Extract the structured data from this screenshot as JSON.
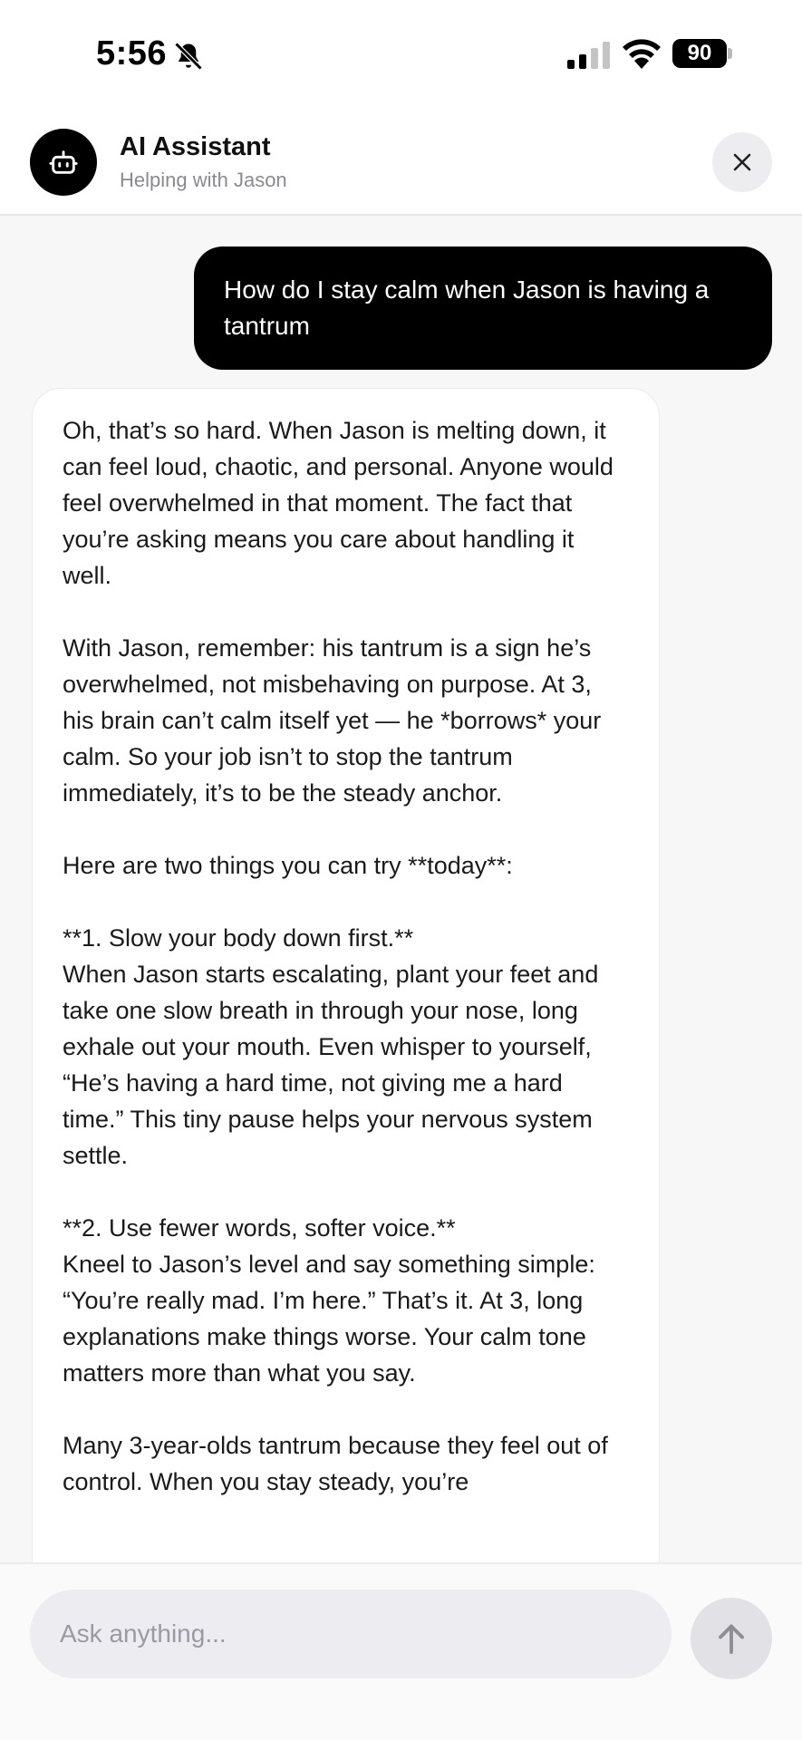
{
  "status_bar": {
    "time": "5:56",
    "battery": "90",
    "icons": [
      "bell-slash-icon",
      "cellular-signal-icon",
      "wifi-icon",
      "battery-icon"
    ]
  },
  "header": {
    "title": "AI Assistant",
    "subtitle": "Helping with Jason",
    "avatar_icon": "robot-icon",
    "close_icon": "close-icon"
  },
  "messages": {
    "user": "How do I stay calm when Jason is having a tantrum",
    "assistant": {
      "p1": "Oh, that’s so hard. When Jason is melting down, it can feel loud, chaotic, and personal. Anyone would feel overwhelmed in that moment. The fact that you’re asking means you care about handling it well.",
      "p2": "With Jason, remember: his tantrum is a sign he’s overwhelmed, not misbehaving on purpose. At 3, his brain can’t calm itself yet — he *borrows* your calm. So your job isn’t to stop the tantrum immediately, it’s to be the steady anchor.",
      "p3": "Here are two things you can try **today**:",
      "p4_heading": "**1. Slow your body down first.**",
      "p4_body": "When Jason starts escalating, plant your feet and take one slow breath in through your nose, long exhale out your mouth. Even whisper to yourself, “He’s having a hard time, not giving me a hard time.” This tiny pause helps your nervous system settle.",
      "p5_heading": "**2. Use fewer words, softer voice.**",
      "p5_body": "Kneel to Jason’s level and say something simple: “You’re really mad. I’m here.” That’s it. At 3, long explanations make things worse. Your calm tone matters more than what you say.",
      "p6": "Many 3-year-olds tantrum because they feel out of control. When you stay steady, you’re"
    }
  },
  "input": {
    "placeholder": "Ask anything...",
    "value": "",
    "send_icon": "arrow-up-icon"
  },
  "colors": {
    "user_bubble": "#000000",
    "background": "#f7f7f8",
    "input_field": "#ececf1",
    "send_button": "#e2e2e6"
  }
}
